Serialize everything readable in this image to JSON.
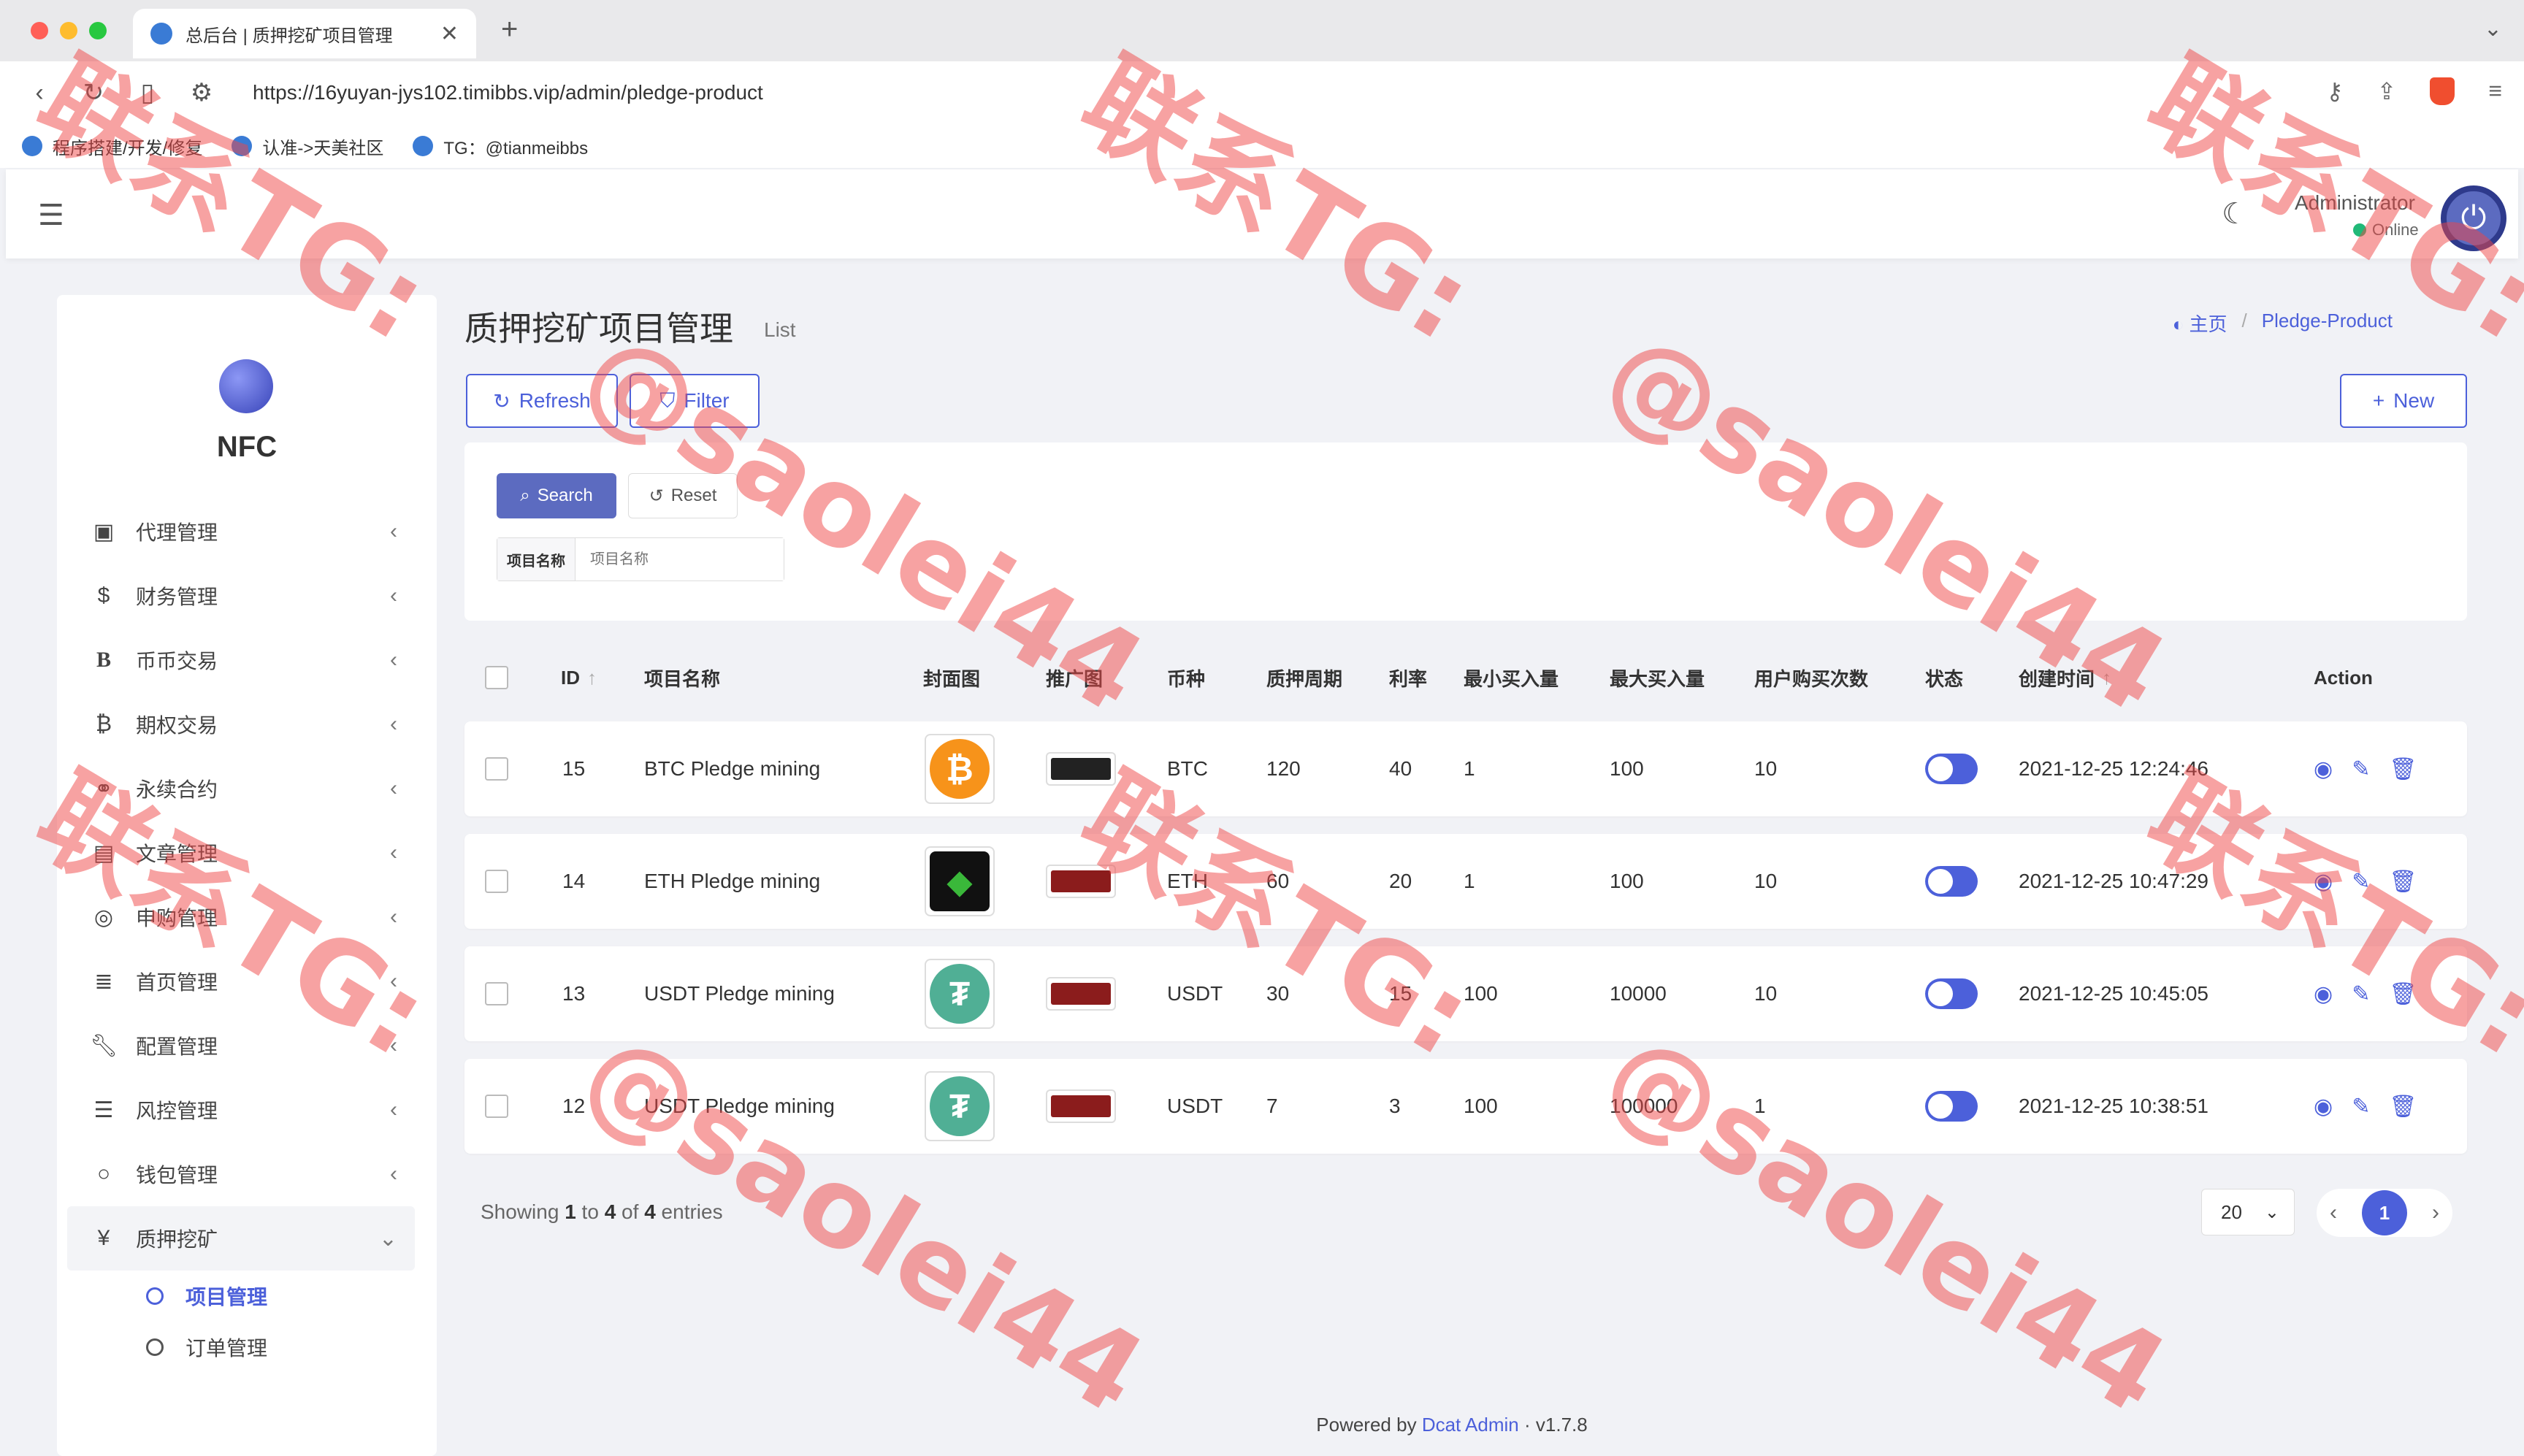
{
  "browser": {
    "tab_title": "总后台 | 质押挖矿项目管理",
    "url": "https://16yuyan-jys102.timibbs.vip/admin/pledge-product",
    "bookmarks": [
      "程序搭建/开发/修复",
      "认准->天美社区",
      "TG：@tianmeibbs"
    ]
  },
  "header": {
    "admin_name": "Administrator",
    "status": "Online"
  },
  "sidebar": {
    "brand": "NFC",
    "items": [
      {
        "label": "代理管理",
        "icon": "id-card-icon"
      },
      {
        "label": "财务管理",
        "icon": "dollar-icon"
      },
      {
        "label": "币币交易",
        "icon": "bold-b-icon"
      },
      {
        "label": "期权交易",
        "icon": "bitcoin-icon"
      },
      {
        "label": "永续合约",
        "icon": "link-icon"
      },
      {
        "label": "文章管理",
        "icon": "newspaper-icon"
      },
      {
        "label": "申购管理",
        "icon": "lifebuoy-icon"
      },
      {
        "label": "首页管理",
        "icon": "list-icon"
      },
      {
        "label": "配置管理",
        "icon": "wrench-icon"
      },
      {
        "label": "风控管理",
        "icon": "indent-icon"
      },
      {
        "label": "钱包管理",
        "icon": "circle-icon"
      },
      {
        "label": "质押挖矿",
        "icon": "yen-icon"
      }
    ],
    "sub_items": [
      "项目管理",
      "订单管理"
    ]
  },
  "page": {
    "title": "质押挖矿项目管理",
    "subtitle": "List",
    "breadcrumb_home": "主页",
    "breadcrumb_current": "Pledge-Product",
    "refresh_label": "Refresh",
    "filter_label": "Filter",
    "new_label": "New",
    "search_label": "Search",
    "reset_label": "Reset",
    "filter_field_label": "项目名称",
    "filter_field_placeholder": "项目名称"
  },
  "table": {
    "headers": {
      "id": "ID",
      "name": "项目名称",
      "cover": "封面图",
      "promo": "推广图",
      "coin": "币种",
      "period": "质押周期",
      "rate": "利率",
      "min": "最小买入量",
      "max": "最大买入量",
      "times": "用户购买次数",
      "status": "状态",
      "created": "创建时间",
      "action": "Action"
    },
    "rows": [
      {
        "id": "15",
        "name": "BTC Pledge mining",
        "coin": "BTC",
        "period": "120",
        "rate": "40",
        "min": "1",
        "max": "100",
        "times": "10",
        "created": "2021-12-25 12:24:46"
      },
      {
        "id": "14",
        "name": "ETH Pledge mining",
        "coin": "ETH",
        "period": "60",
        "rate": "20",
        "min": "1",
        "max": "100",
        "times": "10",
        "created": "2021-12-25 10:47:29"
      },
      {
        "id": "13",
        "name": "USDT Pledge mining",
        "coin": "USDT",
        "period": "30",
        "rate": "15",
        "min": "100",
        "max": "10000",
        "times": "10",
        "created": "2021-12-25 10:45:05"
      },
      {
        "id": "12",
        "name": "USDT Pledge mining",
        "coin": "USDT",
        "period": "7",
        "rate": "3",
        "min": "100",
        "max": "100000",
        "times": "1",
        "created": "2021-12-25 10:38:51"
      }
    ]
  },
  "pagination": {
    "showing_prefix": "Showing",
    "from": "1",
    "to_word": "to",
    "to": "4",
    "of_word": "of",
    "total": "4",
    "suffix": "entries",
    "per_page": "20",
    "current_page": "1"
  },
  "footer": {
    "prefix": "Powered by",
    "link": "Dcat Admin",
    "version": "· v1.7.8"
  },
  "watermark": {
    "line1": "联系TG:",
    "line2": "@saolei44"
  },
  "colors": {
    "accent": "#4c60da",
    "online": "#21b978",
    "watermark": "#f04646"
  }
}
